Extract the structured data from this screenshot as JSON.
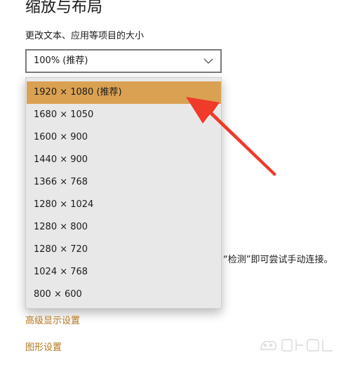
{
  "section": {
    "title": "缩放与布局"
  },
  "scale": {
    "label": "更改文本、应用等项目的大小",
    "selected_value": "100% (推荐)"
  },
  "resolution": {
    "options": [
      "1920 × 1080 (推荐)",
      "1680 × 1050",
      "1600 × 900",
      "1440 × 900",
      "1366 × 768",
      "1280 × 1024",
      "1280 × 800",
      "1280 × 720",
      "1024 × 768",
      "800 × 600"
    ],
    "selected_index": 0
  },
  "hint": {
    "text": "“检测”即可尝试手动连接。"
  },
  "links": {
    "advanced_display": "高级显示设置",
    "graphics": "图形设置"
  },
  "colors": {
    "selected_option": "#dba152",
    "link": "#b5761e",
    "annotation_arrow": "#f03a2a"
  },
  "icons": {
    "dropdown": "chevron-down-icon",
    "annotation": "red-arrow-icon"
  }
}
